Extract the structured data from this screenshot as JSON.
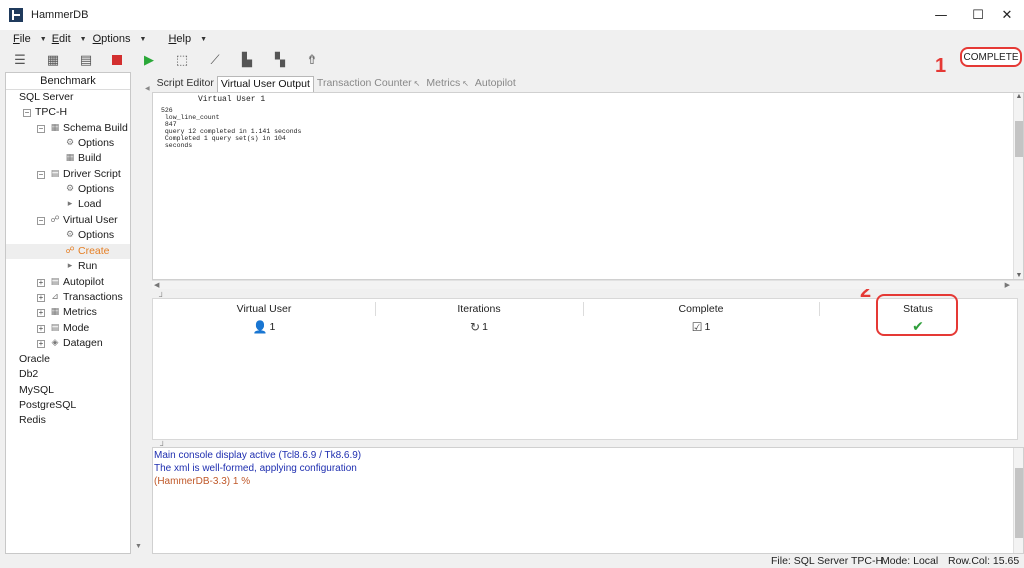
{
  "window": {
    "title": "HammerDB",
    "minimize_glyph": "—",
    "maximize_glyph": "☐",
    "close_glyph": "✕"
  },
  "menubar": {
    "items": [
      {
        "key": "F",
        "rest": "ile"
      },
      {
        "key": "E",
        "rest": "dit"
      },
      {
        "key": "O",
        "rest": "ptions"
      },
      {
        "key": "H",
        "rest": "elp"
      }
    ]
  },
  "toolbar": {
    "icons": [
      "menu-icon",
      "grid-icon",
      "script-icon",
      "stop-icon",
      "run-icon",
      "build-icon",
      "metrics-icon",
      "chart-icon",
      "transactions-icon",
      "autopilot-icon"
    ],
    "stop_color": "#d32f2f",
    "run_color": "#2aa838"
  },
  "status_indicator": {
    "label": "COMPLETE"
  },
  "annotations": {
    "one": "1",
    "two": "2",
    "color": "#e53935"
  },
  "tree": {
    "header": "Benchmark",
    "nodes": [
      {
        "label": "SQL Server",
        "box": "⊟",
        "icon": ""
      },
      {
        "label": "TPC-H",
        "box": "⊟",
        "icon": ""
      },
      {
        "label": "Schema Build",
        "box": "⊟",
        "icon": "▦"
      },
      {
        "label": "Options",
        "box": "",
        "icon": "⚙"
      },
      {
        "label": "Build",
        "box": "",
        "icon": "▦"
      },
      {
        "label": "Driver Script",
        "box": "⊟",
        "icon": "▤"
      },
      {
        "label": "Options",
        "box": "",
        "icon": "⚙"
      },
      {
        "label": "Load",
        "box": "",
        "icon": "▸"
      },
      {
        "label": "Virtual User",
        "box": "⊟",
        "icon": "☍"
      },
      {
        "label": "Options",
        "box": "",
        "icon": "⚙"
      },
      {
        "label": "Create",
        "box": "",
        "icon": "☍"
      },
      {
        "label": "Run",
        "box": "",
        "icon": "▸"
      },
      {
        "label": "Autopilot",
        "box": "⊞",
        "icon": "▤"
      },
      {
        "label": "Transactions",
        "box": "⊞",
        "icon": "⊿"
      },
      {
        "label": "Metrics",
        "box": "⊞",
        "icon": "▦"
      },
      {
        "label": "Mode",
        "box": "⊞",
        "icon": "▤"
      },
      {
        "label": "Datagen",
        "box": "⊞",
        "icon": "◈"
      },
      {
        "label": "Oracle",
        "box": "",
        "icon": ""
      },
      {
        "label": "Db2",
        "box": "",
        "icon": ""
      },
      {
        "label": "MySQL",
        "box": "",
        "icon": ""
      },
      {
        "label": "PostgreSQL",
        "box": "",
        "icon": ""
      },
      {
        "label": "Redis",
        "box": "",
        "icon": ""
      }
    ]
  },
  "tabs": [
    {
      "label": "Script Editor"
    },
    {
      "label": "Virtual User Output"
    },
    {
      "label": "Transaction Counter"
    },
    {
      "label": "Metrics"
    },
    {
      "label": "Autopilot"
    }
  ],
  "output": {
    "header": "Virtual User 1",
    "lines": [
      "526",
      " low_line_count",
      " 847",
      " query 12 completed in 1.141 seconds",
      " Completed 1 query set(s) in 104",
      " seconds"
    ]
  },
  "vu_table": {
    "headers": [
      "Virtual User",
      "Iterations",
      "Complete",
      "Status"
    ],
    "row": {
      "virtual_user": "1",
      "iterations": "1",
      "complete": "1",
      "status_glyph": "✔"
    }
  },
  "console": {
    "lines": [
      "Main console display active (Tcl8.6.9 / Tk8.6.9)",
      "The xml is well-formed, applying configuration",
      "(HammerDB-3.3) 1 %"
    ]
  },
  "statusbar": {
    "file": "File: SQL Server TPC-H",
    "mode": "Mode: Local",
    "rowcol": "Row.Col:  15.65"
  }
}
